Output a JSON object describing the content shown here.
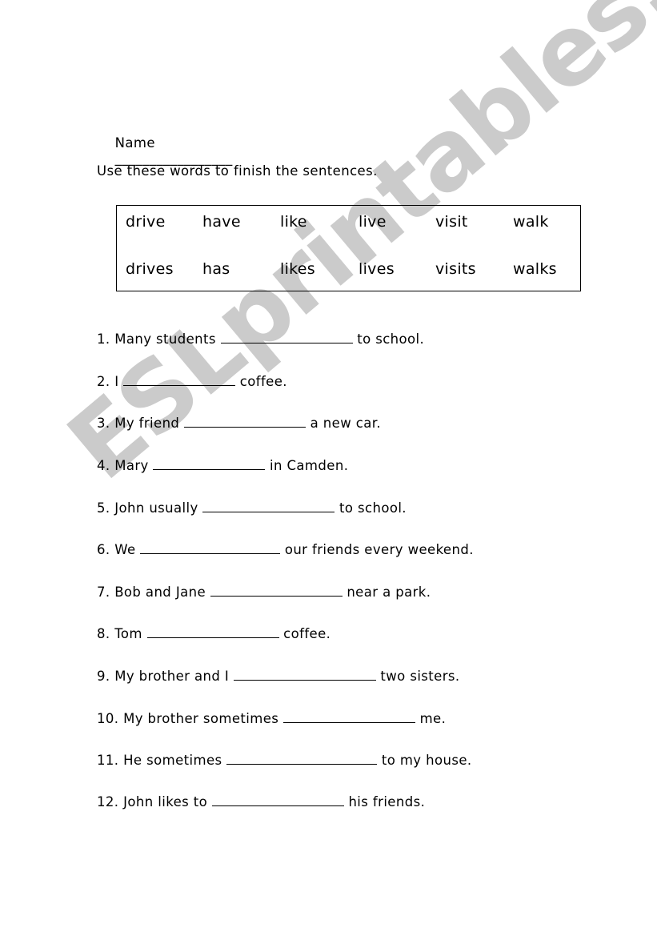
{
  "worksheet": {
    "name_label": "Name",
    "name_blank": "_________________",
    "instruction": "Use these words to finish the sentences.",
    "word_bank": {
      "row1": [
        "drive",
        "have",
        "like",
        "live",
        "visit",
        "walk"
      ],
      "row2": [
        "drives",
        "has",
        "likes",
        "lives",
        "visits",
        "walks"
      ]
    },
    "questions": [
      {
        "number": "1.",
        "before": "Many students",
        "after": "to school."
      },
      {
        "number": "2.",
        "before": "I",
        "after": "coffee."
      },
      {
        "number": "3.",
        "before": "My friend",
        "after": "a new car."
      },
      {
        "number": "4.",
        "before": "Mary",
        "after": "in Camden."
      },
      {
        "number": "5.",
        "before": "John usually",
        "after": "to school."
      },
      {
        "number": "6.",
        "before": "We",
        "after": "our friends every weekend."
      },
      {
        "number": "7.",
        "before": "Bob and Jane",
        "after": "near a park."
      },
      {
        "number": "8.",
        "before": "Tom",
        "after": "coffee."
      },
      {
        "number": "9.",
        "before": "My brother and I",
        "after": "two sisters."
      },
      {
        "number": "10.",
        "before": "My brother sometimes",
        "after": "me."
      },
      {
        "number": "11.",
        "before": "He sometimes",
        "after": "to my house."
      },
      {
        "number": "12.",
        "before": "John likes to",
        "after": "his friends."
      }
    ]
  },
  "watermark": {
    "text": "ESLprintables.com",
    "color": "#c9c9c9"
  }
}
